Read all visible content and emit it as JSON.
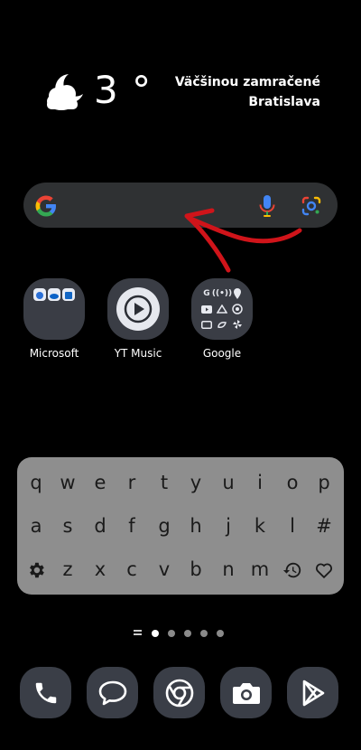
{
  "weather": {
    "temperature": "3 °",
    "condition": "Väčšinou zamračené",
    "location": "Bratislava",
    "icon": "moon-cloud-icon"
  },
  "search": {
    "logo": "google-g-logo",
    "mic_icon": "microphone-icon",
    "lens_icon": "google-lens-icon"
  },
  "apps": [
    {
      "label": "Microsoft"
    },
    {
      "label": "YT Music"
    },
    {
      "label": "Google"
    }
  ],
  "keyboard": {
    "row1": [
      "q",
      "w",
      "e",
      "r",
      "t",
      "y",
      "u",
      "i",
      "o",
      "p"
    ],
    "row2": [
      "a",
      "s",
      "d",
      "f",
      "g",
      "h",
      "j",
      "k",
      "l",
      "#"
    ],
    "row3": [
      "z",
      "x",
      "c",
      "v",
      "b",
      "n",
      "m"
    ]
  },
  "page_indicator": {
    "pages": 5,
    "current": 1
  },
  "dock": [
    {
      "icon": "phone-icon"
    },
    {
      "icon": "messages-icon"
    },
    {
      "icon": "chrome-icon"
    },
    {
      "icon": "camera-icon"
    },
    {
      "icon": "play-store-icon"
    }
  ],
  "colors": {
    "background": "#000000",
    "search_bar": "#2f3133",
    "keyboard": "#8e8e8e",
    "annotation_arrow": "#d0141a",
    "dock_tile": "#3a3e47"
  }
}
